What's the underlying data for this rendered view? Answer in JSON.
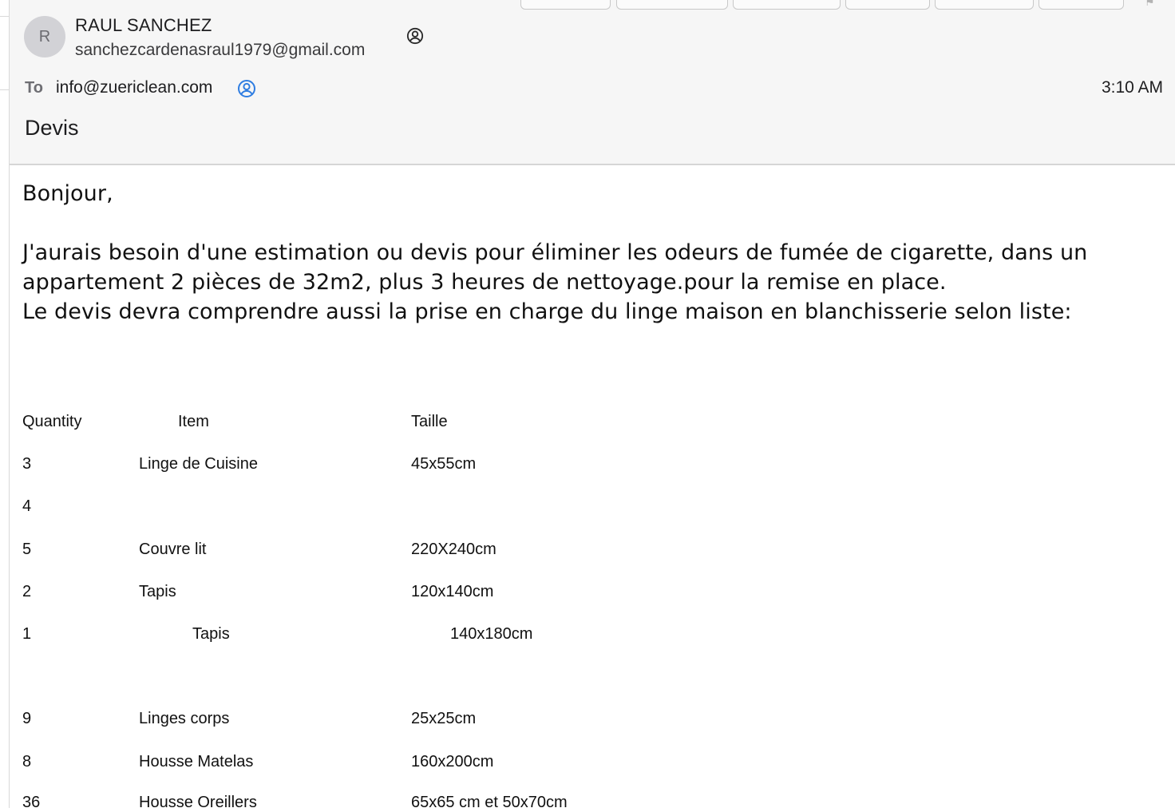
{
  "message": {
    "sender": {
      "initial": "R",
      "name": "RAUL SANCHEZ",
      "email": "sanchezcardenasraul1979@gmail.com"
    },
    "to_label": "To",
    "to_address": "info@zuericlean.com",
    "time": "3:10 AM",
    "subject": "Devis",
    "body": {
      "greeting": "Bonjour,",
      "line1": "J'aurais besoin d'une estimation ou devis pour éliminer les odeurs de fumée de cigarette,  dans un",
      "line2": "appartement 2 pièces de 32m2, plus 3 heures de nettoyage.pour la remise en place.",
      "line3": "Le devis devra comprendre aussi la prise en charge du linge maison en blanchisserie selon liste:"
    },
    "table": {
      "headers": {
        "quantity": "Quantity",
        "item": "Item",
        "size": "Taille"
      },
      "rows": [
        {
          "qty": "3",
          "item": "Linge de Cuisine",
          "size": "45x55cm"
        },
        {
          "qty": "4",
          "item": "",
          "size": ""
        },
        {
          "qty": "5",
          "item": "Couvre lit",
          "size": "220X240cm"
        },
        {
          "qty": "2",
          "item": "Tapis",
          "size": "120x140cm"
        },
        {
          "qty": "1",
          "item": "Tapis",
          "size": "140x180cm"
        },
        {
          "qty": "9",
          "item": "Linges corps",
          "size": "25x25cm"
        },
        {
          "qty": "8",
          "item": "Housse Matelas",
          "size": "160x200cm"
        },
        {
          "qty": "36",
          "item": "Housse Oreillers",
          "size": "65x65 cm et 50x70cm"
        }
      ]
    }
  },
  "icons": {
    "contact": "person-circle-icon",
    "recipient": "person-circle-blue-icon",
    "flag": "flag-icon"
  },
  "colors": {
    "header_bg": "#f6f6f6",
    "recipient_icon": "#2f7de1"
  }
}
